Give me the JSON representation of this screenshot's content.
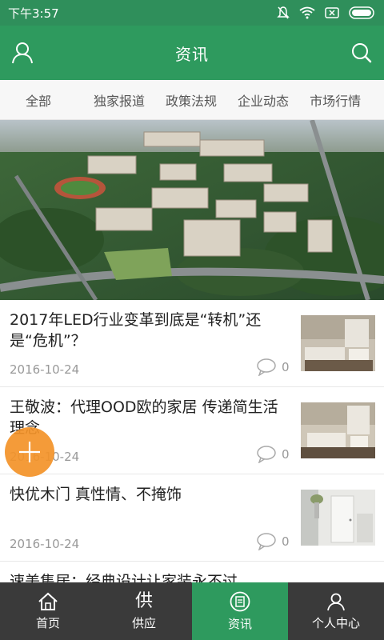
{
  "status_bar": {
    "time": "下午3:57",
    "icons": [
      "mute-icon",
      "wifi-icon",
      "sim-icon",
      "battery-icon"
    ]
  },
  "header": {
    "title": "资讯",
    "left_icon": "user-icon",
    "right_icon": "search-icon"
  },
  "tabs": [
    "全部",
    "独家报道",
    "政策法规",
    "企业动态",
    "市场行情"
  ],
  "news": [
    {
      "title": "2017年LED行业变革到底是“转机”还是“危机”？",
      "date": "2016-10-24",
      "comments": "0"
    },
    {
      "title": "王敬波：代理OOD欧的家居 传递简生活理念",
      "date": "2016-10-24",
      "comments": "0"
    },
    {
      "title": "快优木门 真性情、不掩饰",
      "date": "2016-10-24",
      "comments": "0"
    },
    {
      "title": "速美集居：经典设计让家装永不过",
      "date": "",
      "comments": ""
    }
  ],
  "fab": {
    "icon": "plus-icon"
  },
  "bottom_nav": [
    {
      "label": "首页",
      "icon": "home-icon"
    },
    {
      "label": "供应",
      "icon_char": "供"
    },
    {
      "label": "资讯",
      "icon": "news-icon",
      "active": true
    },
    {
      "label": "个人中心",
      "icon": "user-icon"
    }
  ],
  "colors": {
    "primary": "#2e9a5e",
    "status": "#2f8f5b",
    "nav_bg": "#3a3a3a",
    "fab": "#f39228"
  }
}
